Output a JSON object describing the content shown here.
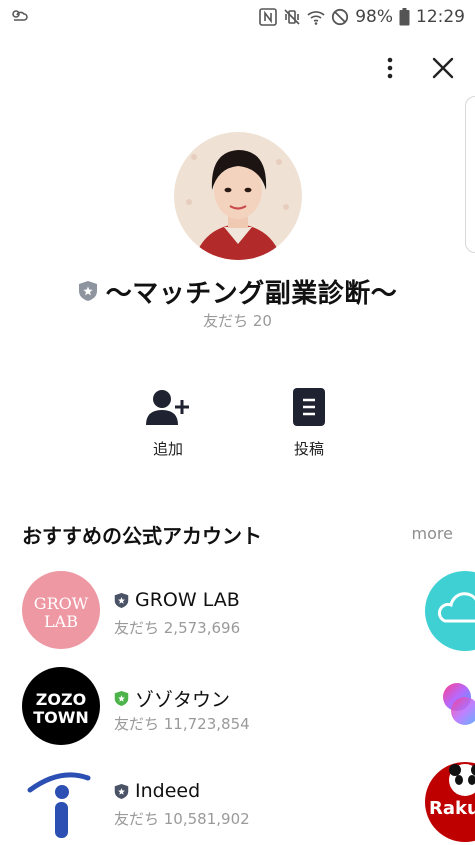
{
  "status_bar": {
    "battery": "98%",
    "time": "12:29"
  },
  "icons": {
    "weather": "weather-icon",
    "nfc": "nfc-icon",
    "vibrate": "vibrate-icon",
    "wifi": "wifi-icon",
    "dnd": "do-not-disturb-icon",
    "battery": "battery-icon",
    "menu": "more-vert-icon",
    "close": "close-icon",
    "add_friend": "add-friend-icon",
    "posts": "posts-icon",
    "verified": "verified-badge-icon"
  },
  "profile": {
    "name": "〜マッチング副業診断〜",
    "friends": "友だち 20"
  },
  "actions": [
    {
      "label": "追加"
    },
    {
      "label": "投稿"
    }
  ],
  "recommended": {
    "title": "おすすめの公式アカウント",
    "more": "more",
    "accounts": [
      {
        "name": "GROW LAB",
        "friends": "友だち 2,573,696",
        "logo_text": [
          "GROW",
          "LAB"
        ],
        "logo_bg": "#ee98a4",
        "badge_color": "#4a5266"
      },
      {
        "name": "ゾゾタウン",
        "friends": "友だち 11,723,854",
        "logo_text": [
          "ZOZO",
          "TOWN"
        ],
        "logo_bg": "#000000",
        "badge_color": "#4cb34a"
      },
      {
        "name": "Indeed",
        "friends": "友だち 10,581,902",
        "logo_text": [
          "i"
        ],
        "logo_bg": "#ffffff",
        "badge_color": "#4a5266"
      }
    ],
    "peek_text": "Raku"
  },
  "colors": {
    "brand_blue": "#2b4fb3",
    "cloud_teal": "#3fd0d4",
    "rakuten_red": "#bf0000"
  }
}
